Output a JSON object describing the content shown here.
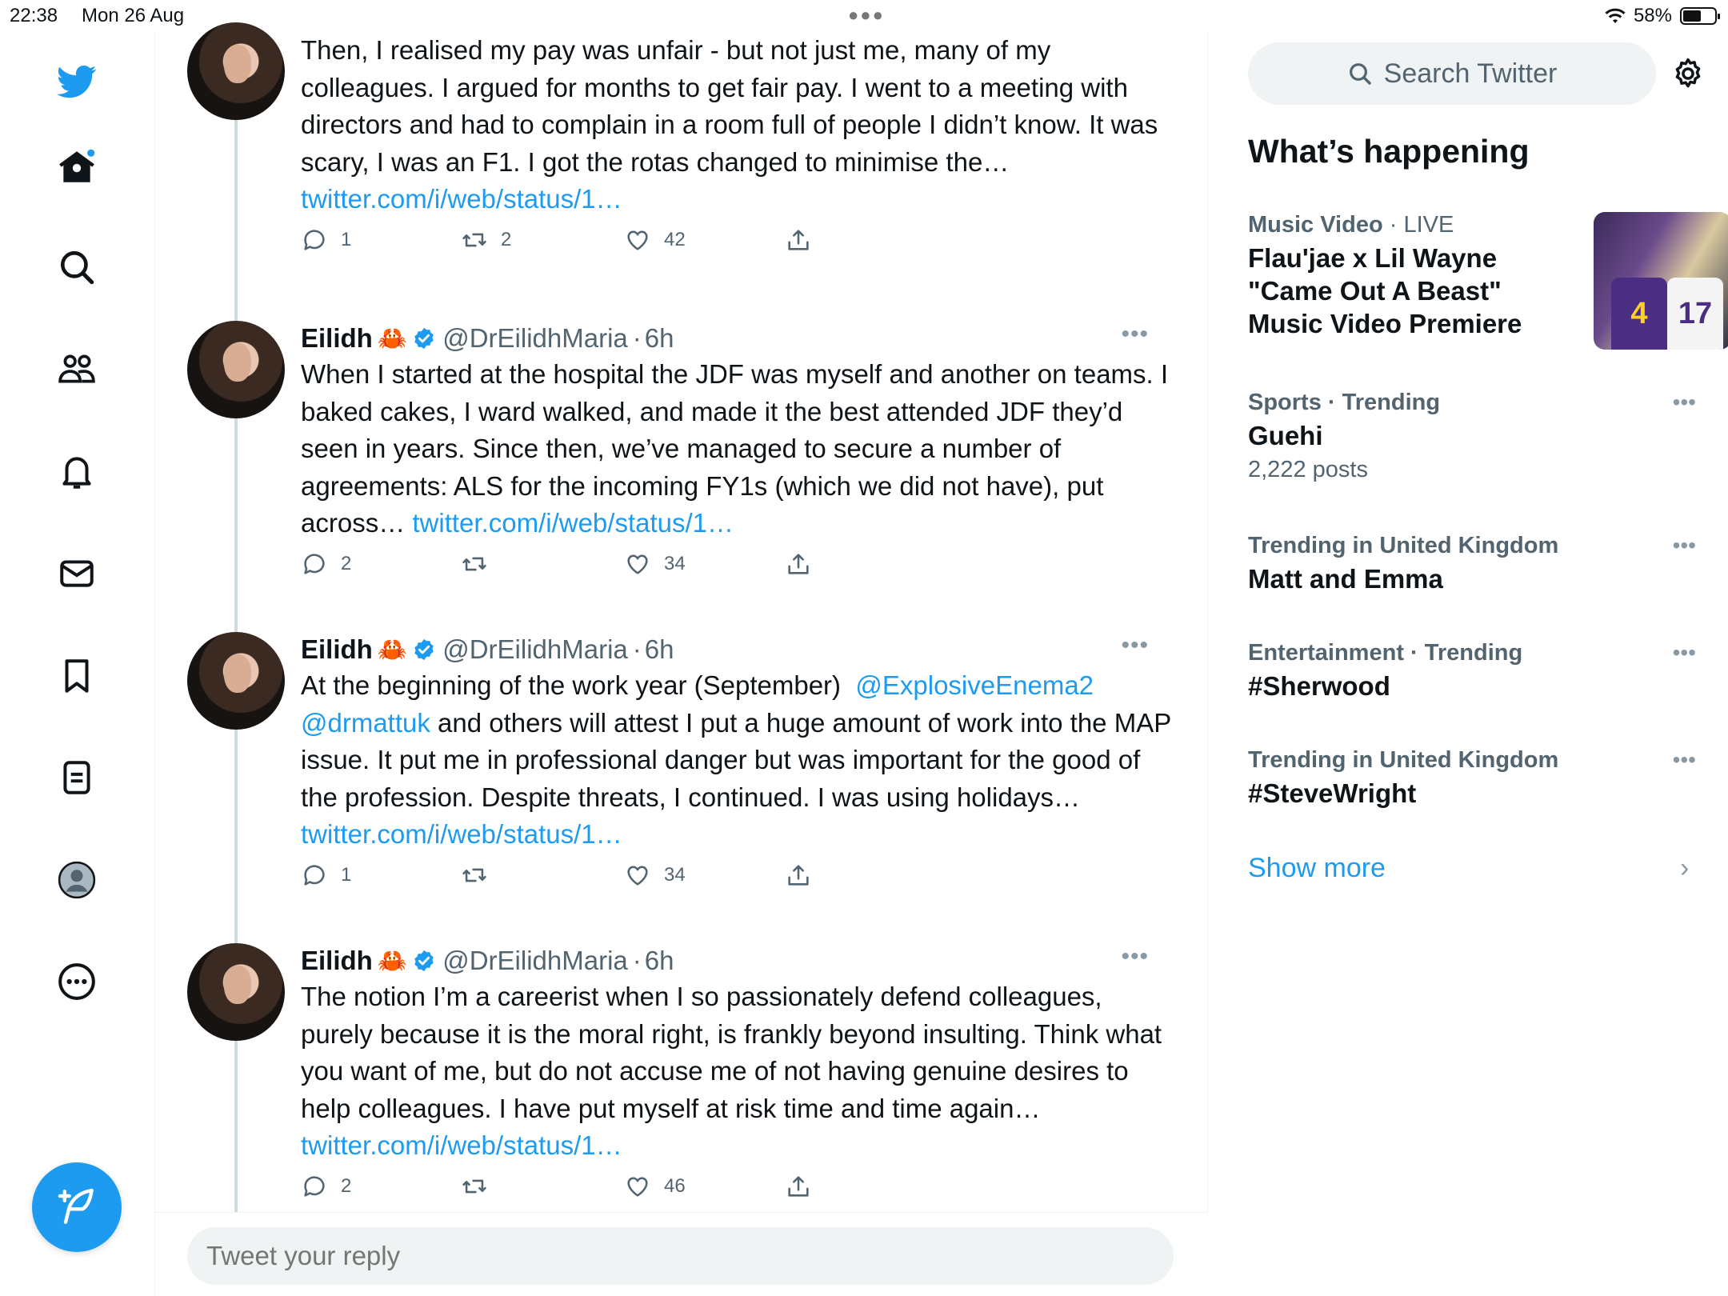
{
  "status_bar": {
    "time": "22:38",
    "date": "Mon 26 Aug",
    "battery": "58%",
    "battery_level": 0.58
  },
  "nav": {
    "items": [
      "twitter-logo",
      "home",
      "explore",
      "communities",
      "notifications",
      "messages",
      "bookmarks",
      "lists",
      "profile",
      "more"
    ],
    "home_has_dot": true
  },
  "tweets": [
    {
      "name": "",
      "handle": "",
      "time": "",
      "text": "Then, I realised my pay was unfair - but not just me, many of my colleagues. I argued for months to get fair pay. I went to a meeting with directors and had to complain in a room full of people I didn’t know. It was scary, I was an F1. I got the rotas changed to minimise the…",
      "link": "twitter.com/i/web/status/1…",
      "replies": "1",
      "retweets": "2",
      "likes": "42"
    },
    {
      "name": "Eilidh",
      "emoji": "🦀",
      "handle": "@DrEilidhMaria",
      "time": "6h",
      "text": "When I started at the hospital the JDF was myself and another on teams. I baked cakes, I ward walked, and made it the best attended JDF they’d seen in years. Since then, we’ve managed to secure a number of agreements: ALS for the incoming FY1s (which we did not have), put across… ",
      "link": "twitter.com/i/web/status/1…",
      "replies": "2",
      "retweets": "",
      "likes": "34"
    },
    {
      "name": "Eilidh",
      "emoji": "🦀",
      "handle": "@DrEilidhMaria",
      "time": "6h",
      "text_before": "At the beginning of the work year (September)  ",
      "mention1": "@ExplosiveEnema2",
      "mention2": "@drmattuk",
      "text": " and others will attest I put a huge amount of work into the MAP issue. It put me in professional danger but was important for the good of the profession. Despite threats, I continued. I was using holidays… ",
      "link": "twitter.com/i/web/status/1…",
      "replies": "1",
      "retweets": "",
      "likes": "34"
    },
    {
      "name": "Eilidh",
      "emoji": "🦀",
      "handle": "@DrEilidhMaria",
      "time": "6h",
      "text": "The notion I’m a careerist when I so passionately defend colleagues, purely because it is the moral right, is frankly beyond insulting. Think what you want of me, but do not accuse me of not having genuine desires to help colleagues. I have put myself at risk time and time again… ",
      "link": "twitter.com/i/web/status/1…",
      "replies": "2",
      "retweets": "",
      "likes": "46"
    }
  ],
  "reply": {
    "placeholder": "Tweet your reply"
  },
  "search": {
    "placeholder": "Search Twitter"
  },
  "sidebar": {
    "heading": "What’s happening",
    "trends": [
      {
        "context": "Music Video",
        "live": "LIVE",
        "title": "Flau'jae x Lil Wayne \"Came Out A Beast\" Music Video Premiere",
        "thumb_numbers": [
          "4",
          "17"
        ]
      },
      {
        "context": "Sports · Trending",
        "title": "Guehi",
        "count": "2,222 posts"
      },
      {
        "context": "Trending in United Kingdom",
        "title": "Matt and Emma"
      },
      {
        "context": "Entertainment · Trending",
        "title": "#Sherwood"
      },
      {
        "context": "Trending in United Kingdom",
        "title": "#SteveWright"
      }
    ],
    "show_more": "Show more"
  },
  "colors": {
    "accent": "#1d9bf0",
    "muted": "#536471",
    "text": "#0f1419",
    "crab": "#e0342a"
  }
}
